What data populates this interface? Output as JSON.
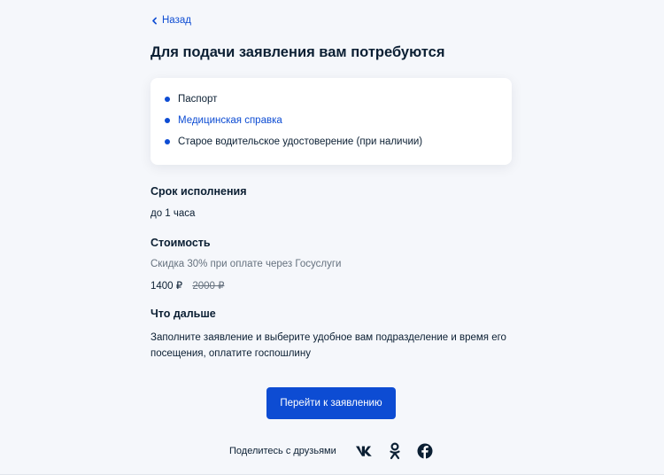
{
  "nav": {
    "back_label": "Назад"
  },
  "page": {
    "title": "Для подачи заявления вам потребуются"
  },
  "documents": {
    "items": [
      {
        "label": "Паспорт",
        "is_link": false
      },
      {
        "label": "Медицинская справка",
        "is_link": true
      },
      {
        "label": "Старое водительское удостоверение (при наличии)",
        "is_link": false
      }
    ]
  },
  "deadline": {
    "title": "Срок исполнения",
    "value": "до 1 часа"
  },
  "cost": {
    "title": "Стоимость",
    "discount_note": "Скидка 30% при оплате через Госуслуги",
    "price": "1400 ₽",
    "old_price": "2000 ₽"
  },
  "next": {
    "title": "Что дальше",
    "line1": "Заполните заявление и выберите удобное вам подразделение и время его",
    "line2": "посещения, оплатите госпошлину"
  },
  "cta": {
    "label": "Перейти к заявлению"
  },
  "share": {
    "label": "Поделитесь с друзьями",
    "networks": [
      "vk-icon",
      "odnoklassniki-icon",
      "facebook-icon"
    ]
  },
  "colors": {
    "accent": "#0d4cd3",
    "text": "#0b1f33",
    "muted": "#66727f",
    "background": "#f5f7fb"
  }
}
